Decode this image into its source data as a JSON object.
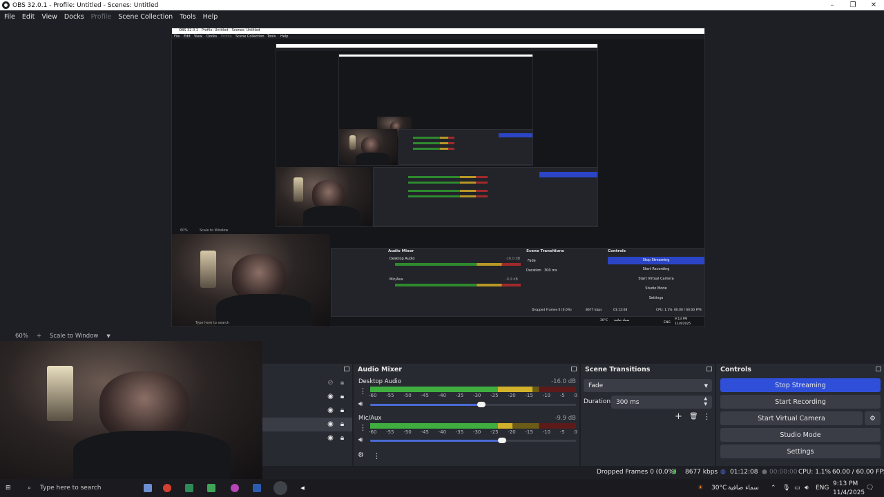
{
  "window": {
    "title": "OBS 32.0.1 - Profile: Untitled - Scenes: Untitled",
    "controls": [
      "–",
      "❐",
      "✕"
    ]
  },
  "menu": [
    {
      "label": "File",
      "enabled": true
    },
    {
      "label": "Edit",
      "enabled": true
    },
    {
      "label": "View",
      "enabled": true
    },
    {
      "label": "Docks",
      "enabled": true
    },
    {
      "label": "Profile",
      "enabled": false
    },
    {
      "label": "Scene Collection",
      "enabled": true
    },
    {
      "label": "Tools",
      "enabled": true
    },
    {
      "label": "Help",
      "enabled": true
    }
  ],
  "preview": {
    "zoom": "60%",
    "zoom_plus": "+",
    "scale_mode": "Scale to Window",
    "nested": {
      "title": "OBS 32.0.1 - Profile: Untitled - Scenes: Untitled",
      "menu": [
        "File",
        "Edit",
        "View",
        "Docks",
        "Profile",
        "Scene Collection",
        "Tools",
        "Help"
      ],
      "audio_mixer": "Audio Mixer",
      "desktop_audio": "Desktop Audio",
      "desktop_db": "-16.0 dB",
      "mic": "Mic/Aux",
      "mic_db": "-9.9 dB",
      "scene_transitions": "Scene Transitions",
      "fade": "Fade",
      "duration": "Duration",
      "duration_val": "300 ms",
      "controls": "Controls",
      "buttons": [
        "Stop Streaming",
        "Start Recording",
        "Start Virtual Camera",
        "Studio Mode",
        "Settings"
      ],
      "status": "Dropped Frames 0 (0.0%)",
      "kbps": "8677 kbps",
      "time": "01:12:08",
      "cpu": "CPU: 1.1%",
      "fps": "60.00 / 60.00 FPS",
      "zoom": "60%",
      "scale_mode": "Scale to Window",
      "search": "Type here to search",
      "clock": "9:13 PM",
      "date": "11/4/2025",
      "weather": "30°C",
      "weather_text": "سماء صافية",
      "lang": "ENG"
    }
  },
  "audio_mixer": {
    "title": "Audio Mixer",
    "scale": [
      "-60",
      "-55",
      "-50",
      "-45",
      "-40",
      "-35",
      "-30",
      "-25",
      "-20",
      "-15",
      "-10",
      "-5",
      "0"
    ],
    "channels": [
      {
        "name": "Desktop Audio",
        "db": "-16.0 dB",
        "level": 0.79,
        "volume": 0.54
      },
      {
        "name": "Mic/Aux",
        "db": "-9.9 dB",
        "level": 0.69,
        "volume": 0.64
      }
    ]
  },
  "scene_transitions": {
    "title": "Scene Transitions",
    "transition": "Fade",
    "duration_label": "Duration",
    "duration_value": "300 ms"
  },
  "controls": {
    "title": "Controls",
    "buttons": [
      "Stop Streaming",
      "Start Recording",
      "Start Virtual Camera",
      "Studio Mode",
      "Settings"
    ]
  },
  "status": {
    "dropped": "Dropped Frames 0 (0.0%)",
    "kbps": "8677 kbps",
    "stream_time": "01:12:08",
    "rec_time": "00:00:00",
    "cpu": "CPU: 1.1%",
    "fps": "60.00 / 60.00 FPS"
  },
  "taskbar": {
    "search_placeholder": "Type here to search",
    "weather_temp": "30°C",
    "weather_text": "سماء صافية",
    "language": "ENG",
    "time": "9:13 PM",
    "date": "11/4/2025"
  },
  "colors": {
    "accent": "#2f4fd9",
    "dock_bg": "#272a31",
    "window_bg": "#1e1f24",
    "button_bg": "#3a3d46"
  }
}
